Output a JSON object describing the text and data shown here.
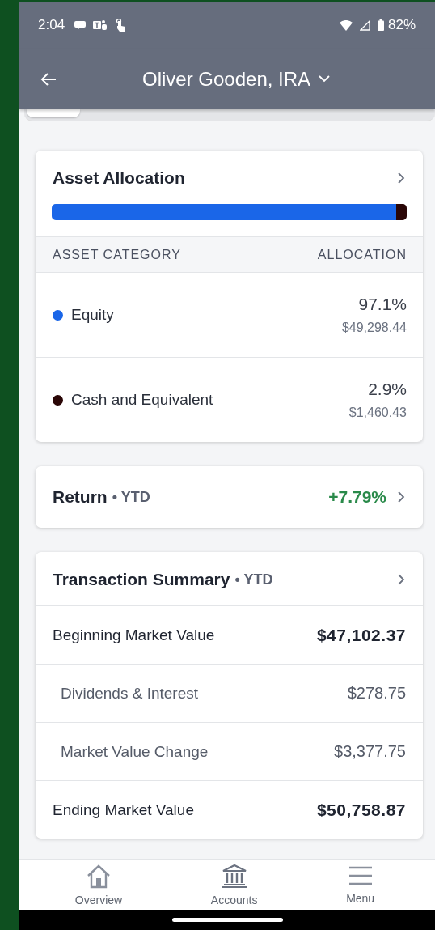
{
  "status_bar": {
    "time": "2:04",
    "battery": "82%"
  },
  "header": {
    "title": "Oliver Gooden, IRA"
  },
  "asset_allocation": {
    "title": "Asset Allocation",
    "columns": [
      "ASSET CATEGORY",
      "ALLOCATION"
    ],
    "rows": [
      {
        "name": "Equity",
        "percent": "97.1%",
        "amount": "$49,298.44",
        "level": 0.971,
        "color": "#1a66e8"
      },
      {
        "name": "Cash and Equivalent",
        "percent": "2.9%",
        "amount": "$1,460.43",
        "level": 0.029,
        "color": "#2a0606"
      }
    ]
  },
  "return": {
    "title": "Return",
    "period": "• YTD",
    "value": "+7.79%"
  },
  "transaction_summary": {
    "title": "Transaction Summary",
    "period": "• YTD",
    "rows": [
      {
        "label": "Beginning Market Value",
        "value": "$47,102.37",
        "kind": "total"
      },
      {
        "label": "Dividends & Interest",
        "value": "$278.75",
        "kind": "detail"
      },
      {
        "label": "Market Value Change",
        "value": "$3,377.75",
        "kind": "detail"
      },
      {
        "label": "Ending Market Value",
        "value": "$50,758.87",
        "kind": "total"
      }
    ]
  },
  "nav": [
    {
      "label": "Overview",
      "kind": "home"
    },
    {
      "label": "Accounts",
      "kind": "bank"
    },
    {
      "label": "Menu",
      "kind": "menu"
    }
  ]
}
